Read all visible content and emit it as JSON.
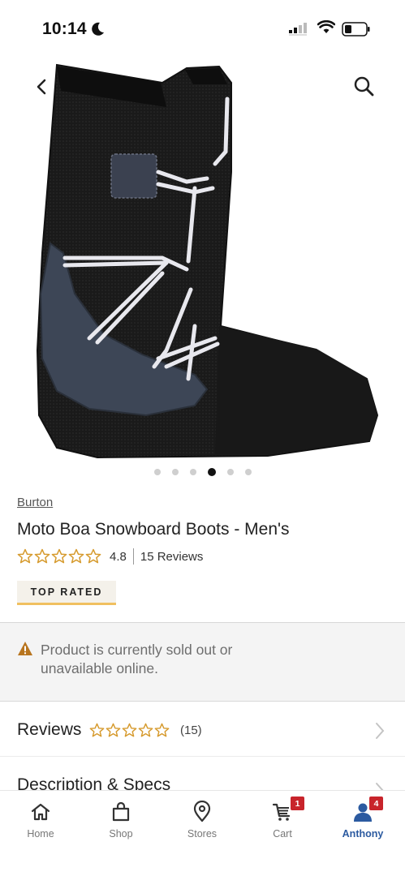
{
  "status_bar": {
    "time": "10:14"
  },
  "hero": {
    "image_alt": "Burton Moto Boa snowboard boot, black with grey shin panel and white laces",
    "carousel": {
      "count": 6,
      "active_index": 3
    }
  },
  "product": {
    "brand": "Burton",
    "title": "Moto Boa Snowboard Boots - Men's",
    "rating": "4.8",
    "rating_fraction": 0.96,
    "reviews_label": "15 Reviews",
    "badge": "TOP RATED"
  },
  "availability": {
    "message": "Product is currently sold out or unavailable online."
  },
  "sections": {
    "reviews_label": "Reviews",
    "reviews_count": "(15)",
    "description_label": "Description & Specs"
  },
  "nav": {
    "items": [
      {
        "label": "Home",
        "icon": "home-icon"
      },
      {
        "label": "Shop",
        "icon": "bag-icon"
      },
      {
        "label": "Stores",
        "icon": "location-pin-icon"
      },
      {
        "label": "Cart",
        "icon": "cart-icon",
        "badge": "1"
      },
      {
        "label": "Anthony",
        "icon": "account-icon",
        "badge": "4"
      }
    ]
  },
  "colors": {
    "accent_blue": "#2b5aa0",
    "star_gold": "#d69a2d",
    "badge_red": "#c8242b",
    "badge_underline": "#f0c060",
    "warning_orange": "#b8751f"
  }
}
